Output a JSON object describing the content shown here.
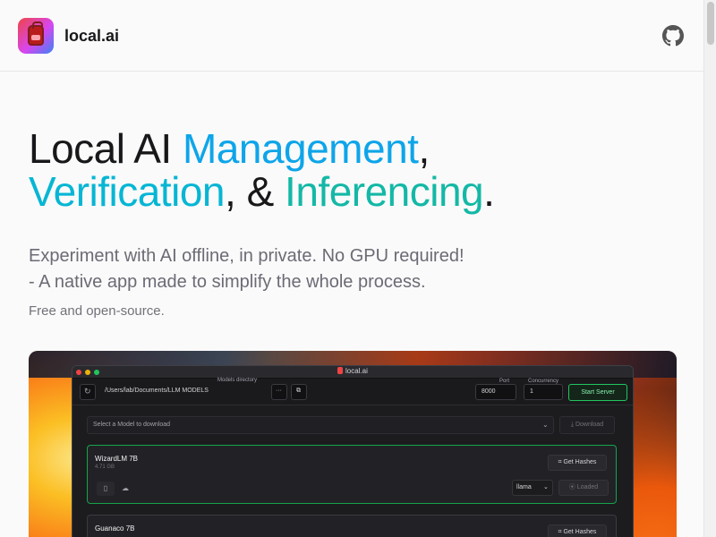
{
  "header": {
    "brand": "local.ai",
    "github_icon": "github-icon"
  },
  "hero": {
    "line1_a": "Local AI ",
    "line1_b": "Management",
    "line1_c": ",",
    "line2_a": "Verification",
    "line2_b": ", & ",
    "line2_c": "Inferencing",
    "line2_d": ".",
    "subtitle_1": "Experiment with AI offline, in private. No GPU required!",
    "subtitle_2": "- A native app made to simplify the whole process.",
    "free": "Free and open-source.",
    "colors": {
      "management": "#0ea5e9",
      "verification": "#06b6d4",
      "inferencing": "#14b8a6"
    }
  },
  "app": {
    "title": "local.ai",
    "models_directory_label": "Models directory",
    "models_directory_value": "/Users/lab/Documents/LLM MODELS",
    "port_label": "Port",
    "port_value": "8000",
    "concurrency_label": "Concurrency",
    "concurrency_value": "1",
    "start_server": "Start Server",
    "select_placeholder": "Select a Model to download",
    "download": "Download",
    "models": [
      {
        "name": "WizardLM 7B",
        "size": "4.71 GB",
        "get_hashes": "Get Hashes",
        "runtime": "llama",
        "status": "Loaded"
      },
      {
        "name": "Guanaco 7B",
        "get_hashes": "Get Hashes"
      }
    ]
  }
}
